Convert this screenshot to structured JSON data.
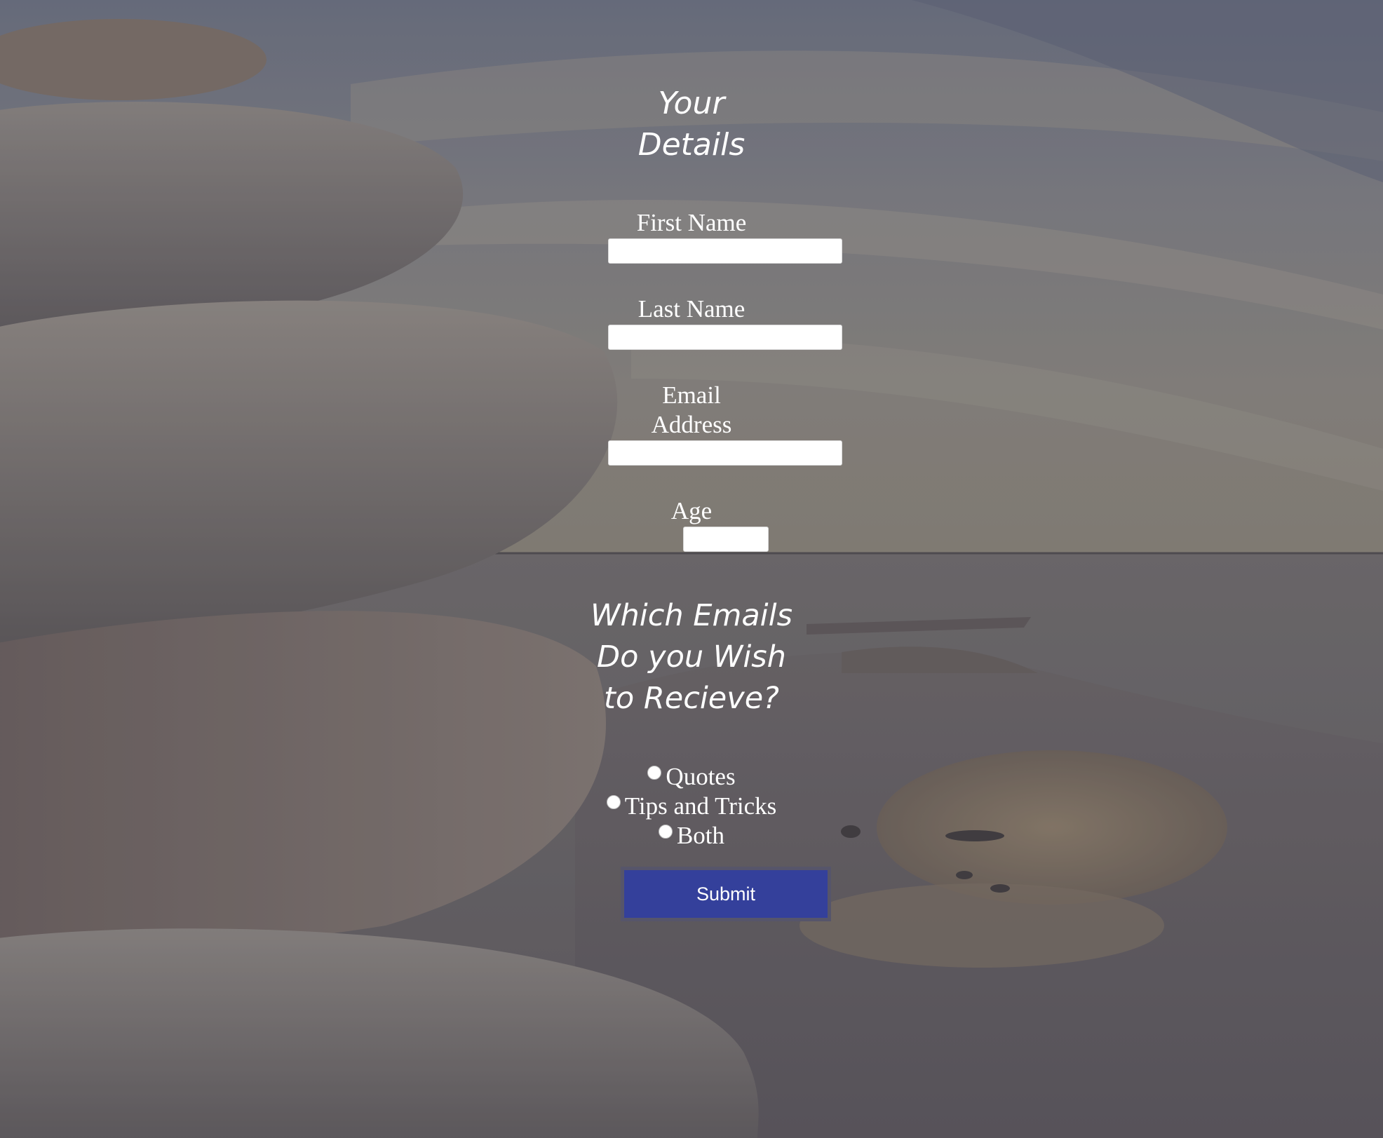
{
  "form": {
    "details_heading": [
      "Your",
      "Details"
    ],
    "fields": {
      "first_name": {
        "label": "First Name",
        "value": ""
      },
      "last_name": {
        "label": "Last Name",
        "value": ""
      },
      "email": {
        "label": [
          "Email",
          "Address"
        ],
        "value": ""
      },
      "age": {
        "label": "Age",
        "value": ""
      }
    },
    "emails_heading": [
      "Which Emails",
      "Do you Wish",
      "to Recieve?"
    ],
    "options": [
      {
        "label": "Quotes",
        "selected": false
      },
      {
        "label": "Tips and Tricks",
        "selected": false
      },
      {
        "label": "Both",
        "selected": false
      }
    ],
    "submit_label": "Submit"
  },
  "background": {
    "description_icon": "stacked-stones-beach-photo",
    "overlay_color": "#5a5a66"
  },
  "colors": {
    "submit_bg": "#34409b",
    "submit_border": "#56556a",
    "text": "#ffffff"
  }
}
